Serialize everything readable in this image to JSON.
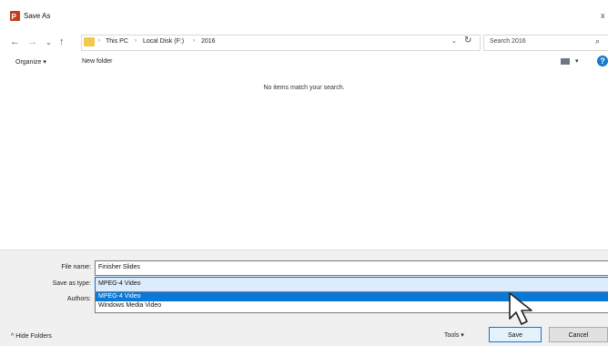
{
  "window": {
    "title": "Save As",
    "close": "x"
  },
  "nav": {
    "back": "←",
    "forward": "→",
    "dropdown": "⌄",
    "up": "↑"
  },
  "address": {
    "sep": "›",
    "crumbs": [
      "This PC",
      "Local Disk (F:)",
      "2016"
    ],
    "dropdown": "⌄",
    "refresh": "↻"
  },
  "search": {
    "placeholder": "Search 2016",
    "icon": "⌕"
  },
  "toolbar": {
    "organize": "Organize ▾",
    "new_folder": "New folder",
    "view_caret": "▾",
    "help": "?"
  },
  "content": {
    "empty_message": "No items match your search."
  },
  "form": {
    "file_name_label": "File name:",
    "file_name_value": "Finisher Slides",
    "save_type_label": "Save as type:",
    "save_type_value": "MPEG-4 Video",
    "authors_label": "Authors:",
    "type_options": [
      "MPEG-4 Video",
      "Windows Media Video"
    ]
  },
  "footer": {
    "hide_folders": "Hide Folders",
    "hide_caret": "^",
    "tools": "Tools ▾",
    "save": "Save",
    "cancel": "Cancel"
  },
  "colors": {
    "accent": "#0a78d7",
    "app_logo": "#c43e1c",
    "folder": "#f2c94c"
  }
}
